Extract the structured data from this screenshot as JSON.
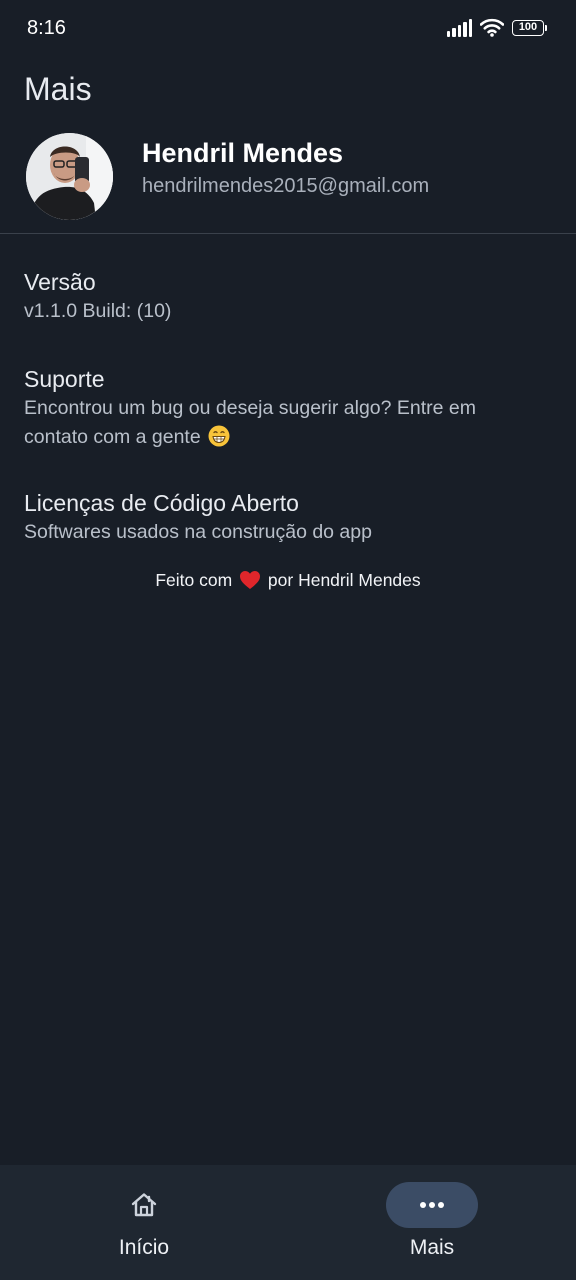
{
  "status_bar": {
    "time": "8:16",
    "battery": "100",
    "icons": [
      "signal-icon",
      "wifi-icon",
      "battery-icon"
    ]
  },
  "header": {
    "title": "Mais"
  },
  "profile": {
    "name": "Hendril Mendes",
    "email": "hendrilmendes2015@gmail.com"
  },
  "items": [
    {
      "title": "Versão",
      "subtitle": "v1.1.0 Build: (10)"
    },
    {
      "title": "Suporte",
      "subtitle_line1": "Encontrou um bug ou deseja sugerir algo? Entre em",
      "subtitle_line2": "contato com a gente",
      "emoji": "grinning-face-icon"
    },
    {
      "title": "Licenças de Código Aberto",
      "subtitle": "Softwares usados na construção do app"
    }
  ],
  "footer": {
    "before_heart": "Feito com",
    "after_heart": "por Hendril Mendes",
    "heart_color": "#e0262b"
  },
  "bottom_nav": [
    {
      "label": "Início",
      "icon": "home-icon",
      "active": false
    },
    {
      "label": "Mais",
      "icon": "more-dots-icon",
      "active": true
    }
  ],
  "colors": {
    "background": "#181e27",
    "nav_background": "#1f2731",
    "active_pill": "#3b4c65",
    "divider": "#3a414b"
  }
}
